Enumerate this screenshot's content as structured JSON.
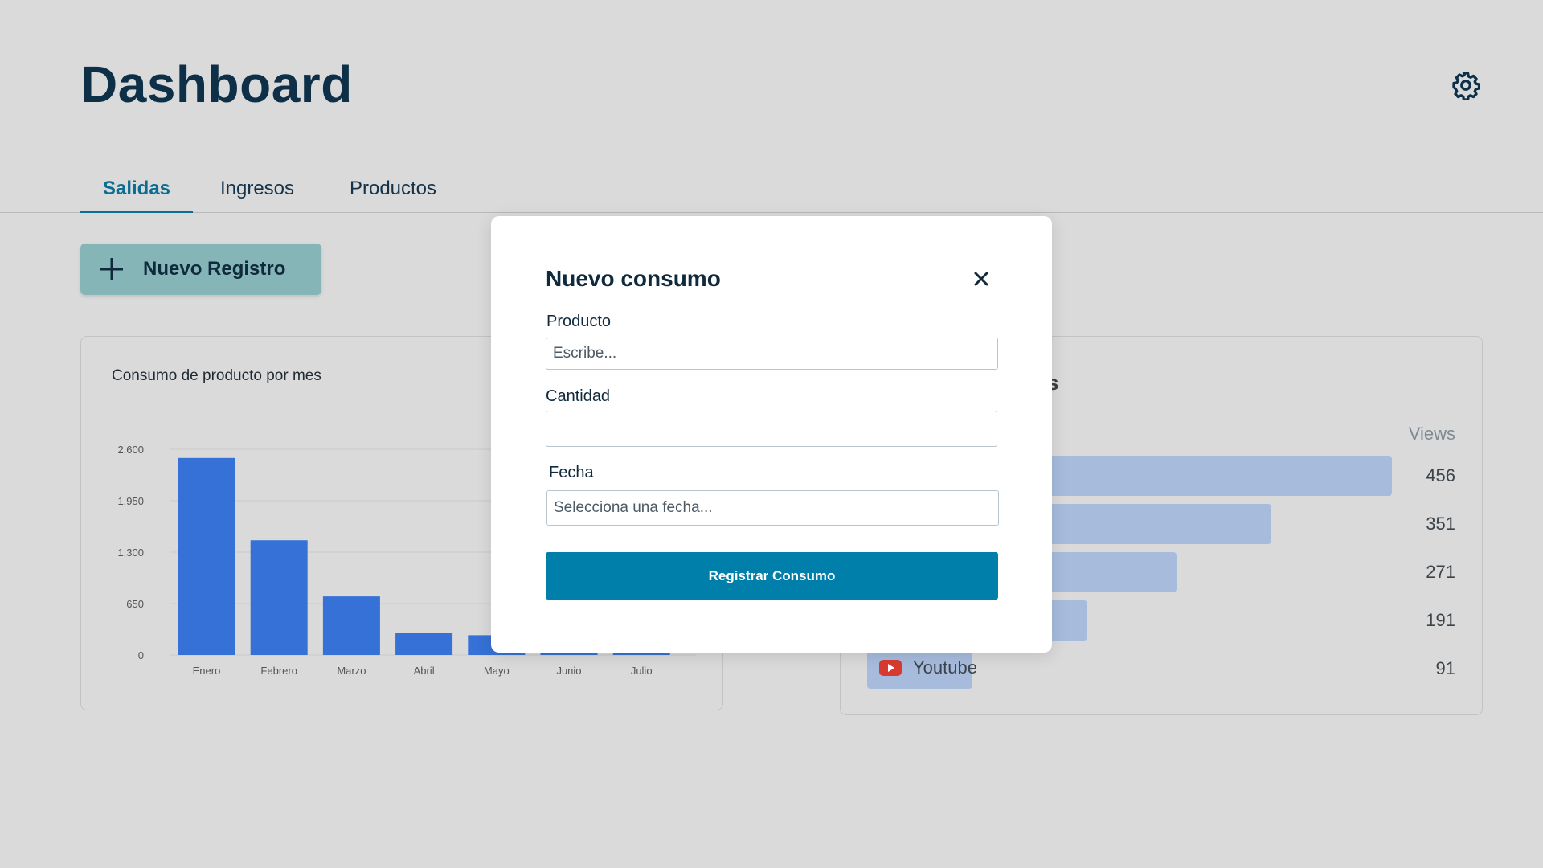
{
  "header": {
    "title": "Dashboard"
  },
  "tabs": [
    {
      "label": "Salidas",
      "active": true
    },
    {
      "label": "Ingresos",
      "active": false
    },
    {
      "label": "Productos",
      "active": false
    }
  ],
  "actions": {
    "new_record_label": "Nuevo Registro"
  },
  "left_card": {
    "title": "Consumo de producto por mes"
  },
  "chart_data": {
    "type": "bar",
    "title": "Consumo de producto por mes",
    "categories": [
      "Enero",
      "Febrero",
      "Marzo",
      "Abril",
      "Mayo",
      "Junio",
      "Julio"
    ],
    "values": [
      2490,
      1450,
      740,
      280,
      250,
      30,
      30
    ],
    "yticks": [
      "0",
      "650",
      "1,300",
      "1,950",
      "2,600"
    ],
    "ylim": [
      0,
      2600
    ],
    "grid": true,
    "bar_color": "#3571d6"
  },
  "right_card": {
    "title_fragment": "s",
    "views_header": "Views",
    "rows": [
      {
        "value": "456",
        "fill": 1.0
      },
      {
        "value": "351",
        "fill": 0.77
      },
      {
        "value": "271",
        "fill": 0.59
      },
      {
        "value": "191",
        "fill": 0.42
      },
      {
        "value": "91",
        "fill": 0.2,
        "label": "Youtube",
        "icon": "youtube-icon"
      }
    ],
    "bar_color": "#a7bcdd"
  },
  "modal": {
    "title": "Nuevo consumo",
    "product_label": "Producto",
    "product_placeholder": "Escribe...",
    "quantity_label": "Cantidad",
    "quantity_value": "",
    "date_label": "Fecha",
    "date_placeholder": "Selecciona una fecha...",
    "submit_label": "Registrar Consumo"
  },
  "colors": {
    "background": "#dadada",
    "primary": "#007faa",
    "accent_button": "#85b5b6",
    "heading": "#0d3048"
  }
}
